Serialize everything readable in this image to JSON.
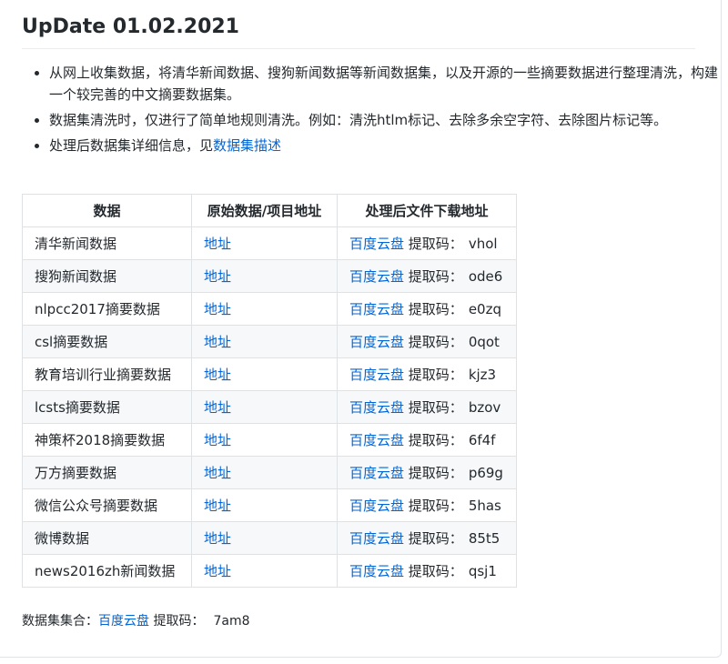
{
  "heading": "UpDate 01.02.2021",
  "bullets": [
    {
      "text": "从网上收集数据，将清华新闻数据、搜狗新闻数据等新闻数据集，以及开源的一些摘要数据进行整理清洗，构建一个较完善的中文摘要数据集。"
    },
    {
      "text": "数据集清洗时，仅进行了简单地规则清洗。例如：清洗htlm标记、去除多余空字符、去除图片标记等。"
    },
    {
      "text": "处理后数据集详细信息，见",
      "link": "数据集描述"
    }
  ],
  "table": {
    "headers": [
      "数据",
      "原始数据/项目地址",
      "处理后文件下载地址"
    ],
    "link_label": "地址",
    "pan_label": "百度云盘",
    "code_label": "提取码：",
    "rows": [
      {
        "name": "清华新闻数据",
        "code": "vhol"
      },
      {
        "name": "搜狗新闻数据",
        "code": "ode6"
      },
      {
        "name": "nlpcc2017摘要数据",
        "code": "e0zq"
      },
      {
        "name": "csl摘要数据",
        "code": "0qot"
      },
      {
        "name": "教育培训行业摘要数据",
        "code": "kjz3"
      },
      {
        "name": "lcsts摘要数据",
        "code": "bzov"
      },
      {
        "name": "神策杯2018摘要数据",
        "code": "6f4f"
      },
      {
        "name": "万方摘要数据",
        "code": "p69g"
      },
      {
        "name": "微信公众号摘要数据",
        "code": "5has"
      },
      {
        "name": "微博数据",
        "code": "85t5"
      },
      {
        "name": "news2016zh新闻数据",
        "code": "qsj1"
      }
    ]
  },
  "footer": {
    "label": "数据集集合：",
    "pan_label": "百度云盘",
    "code_label": "提取码：",
    "code": "7am8"
  }
}
